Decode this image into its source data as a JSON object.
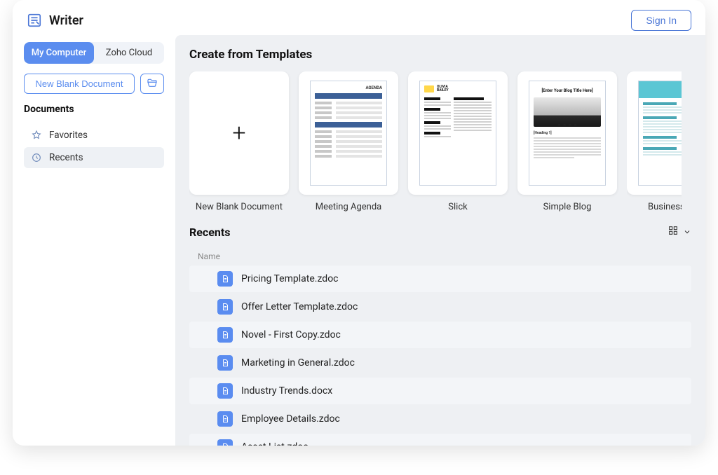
{
  "header": {
    "app_title": "Writer",
    "signin_label": "Sign In"
  },
  "sidebar": {
    "tabs": [
      {
        "label": "My Computer",
        "active": true
      },
      {
        "label": "Zoho Cloud",
        "active": false
      }
    ],
    "new_doc_label": "New Blank Document",
    "documents_heading": "Documents",
    "nav": [
      {
        "label": "Favorites",
        "icon": "star-icon",
        "active": false
      },
      {
        "label": "Recents",
        "icon": "clock-icon",
        "active": true
      }
    ]
  },
  "main": {
    "templates_heading": "Create from Templates",
    "templates": [
      {
        "label": "New Blank Document",
        "kind": "blank"
      },
      {
        "label": "Meeting Agenda",
        "kind": "agenda",
        "inner_title": "AGENDA"
      },
      {
        "label": "Slick",
        "kind": "resume",
        "name_top": "OLIVIA",
        "name_bottom": "BAILEY"
      },
      {
        "label": "Simple Blog",
        "kind": "blog",
        "inner_title": "[Enter Your Blog Title Here]",
        "heading": "[Heading 1]"
      },
      {
        "label": "Business Trip",
        "kind": "trip"
      }
    ],
    "recents_heading": "Recents",
    "name_column": "Name",
    "files": [
      {
        "name": "Pricing Template.zdoc"
      },
      {
        "name": "Offer Letter Template.zdoc"
      },
      {
        "name": "Novel - First Copy.zdoc"
      },
      {
        "name": "Marketing in General.zdoc"
      },
      {
        "name": "Industry Trends.docx"
      },
      {
        "name": "Employee Details.zdoc"
      },
      {
        "name": "Asset List.zdoc"
      }
    ]
  }
}
